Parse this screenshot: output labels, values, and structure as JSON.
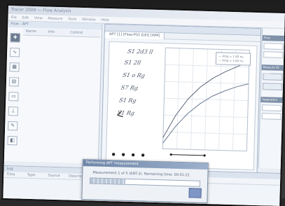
{
  "app": {
    "title": "Tracer 2009 — Flow Analysis",
    "menu": [
      "File",
      "Edit",
      "View",
      "Measure",
      "Tools",
      "Window",
      "Help"
    ]
  },
  "left_panel": {
    "title": "Flow - APT",
    "columns": [
      "Name",
      "Info",
      "Control"
    ],
    "tools": [
      "pointer-icon",
      "curve-icon",
      "table-icon",
      "grid-icon",
      "folder-icon",
      "axis-icon",
      "pen-icon",
      "chart-icon"
    ]
  },
  "document": {
    "tab_label": "APT [1] [Flow-PS1 Edit] [WM]"
  },
  "chart": {
    "legend": [
      "Amp = 1.85 nu",
      "Amp = 1.60 nu"
    ],
    "series_colors": {
      "upper": "#5b6577",
      "lower": "#6b7a92"
    }
  },
  "chart_data": {
    "type": "line",
    "title": "",
    "xlabel": "",
    "ylabel": "",
    "series": [
      {
        "name": "Amp = 1.85 nu",
        "x": [
          0,
          1,
          2,
          3,
          4,
          5,
          6,
          7
        ],
        "values": [
          1,
          3,
          4.5,
          5.6,
          6.4,
          7.0,
          7.5,
          8.0
        ]
      },
      {
        "name": "Amp = 1.60 nu",
        "x": [
          0,
          1,
          2,
          3,
          4,
          5,
          6,
          7
        ],
        "values": [
          0.5,
          2,
          3.2,
          4.1,
          4.8,
          5.3,
          5.7,
          6.0
        ]
      }
    ]
  },
  "right_panel": {
    "section_labels": [
      "Flow",
      "Measure FE Mode",
      "Separation"
    ]
  },
  "bottom_panel": {
    "title": "Log",
    "columns": [
      "Time",
      "Type",
      "Source",
      "Description"
    ]
  },
  "dialog": {
    "title": "Performing APT measurement",
    "message": "Measurement 1 of 5 (ENT-2). Remaining time: 00:01:21",
    "progress": 0.32
  }
}
